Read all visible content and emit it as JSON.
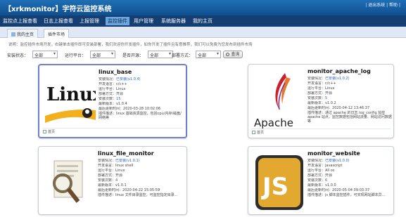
{
  "app": {
    "title": "【xrkmonitor】字符云监控系统",
    "top_right": "| 退出系统 | 帮助 |"
  },
  "nav": {
    "items": [
      {
        "label": "监控点上报查看",
        "active": false
      },
      {
        "label": "日志上报查看",
        "active": false
      },
      {
        "label": "上报管理",
        "active": false
      },
      {
        "label": "监控插件",
        "active": true
      },
      {
        "label": "用户管理",
        "active": false
      },
      {
        "label": "系统服务器",
        "active": false
      },
      {
        "label": "我的主页",
        "active": false
      }
    ]
  },
  "tabs": [
    {
      "label": "我的主页"
    },
    {
      "label": "插件市场"
    }
  ],
  "info_text": "说明：监控插件市场开发，右键单击插件即可安装部署，我们欢迎你开发插件，如你开发了插件且有意推荐，我们可以免费为您发布到插件市场",
  "filters": {
    "install_label": "安装状态：",
    "install_value": "全部",
    "platform_label": "运行平台：",
    "platform_value": "全部",
    "open_label": "是否开源：",
    "open_value": "全部",
    "deploy_label": "部署方式：",
    "deploy_value": "全部",
    "search_label": "查询"
  },
  "plugins": [
    {
      "name": "linux_base",
      "logo": "linux-logo",
      "attrs": [
        {
          "k": "安装情况：",
          "v": "已安装(v1.0.4)",
          "link": true
        },
        {
          "k": "开发语言：",
          "v": "c/c++"
        },
        {
          "k": "运行平台：",
          "v": "Linux"
        },
        {
          "k": "部署方式：",
          "v": "开源"
        },
        {
          "k": "安装次数：",
          "v": "15"
        },
        {
          "k": "最新版本：",
          "v": "v1.0.4"
        },
        {
          "k": "最后更新时间：",
          "v": "2020-03-28 10:02:06"
        }
      ],
      "desc": "插件描述：linux 基础资源监控，包括cpu/内存/磁盘/网络等",
      "footer": "首页"
    },
    {
      "name": "monitor_apache_log",
      "logo": "apache-logo",
      "attrs": [
        {
          "k": "安装情况：",
          "v": "已安装(v1.0.2)",
          "link": true
        },
        {
          "k": "开发语言：",
          "v": "c/c++"
        },
        {
          "k": "运行平台：",
          "v": "Linux"
        },
        {
          "k": "部署方式：",
          "v": "开源"
        },
        {
          "k": "安装次数：",
          "v": "5"
        },
        {
          "k": "最新版本：",
          "v": "v1.0.2"
        },
        {
          "k": "最后更新时间：",
          "v": "2020-04-12 13:46:37"
        }
      ],
      "desc": "插件描述：通过 apache 的日志 log_config 监控 apache 站点，监控数据包括网站流量、网站访问数据等",
      "footer": "首页"
    },
    {
      "name": "linux_file_monitor",
      "logo": "file-monitor-logo",
      "attrs": [
        {
          "k": "安装情况：",
          "v": "已安装(v1.0.1)",
          "link": true
        },
        {
          "k": "开发语言：",
          "v": "linux shell"
        },
        {
          "k": "运行平台：",
          "v": "Linux"
        },
        {
          "k": "部署方式：",
          "v": "开源"
        },
        {
          "k": "安装次数：",
          "v": "4"
        },
        {
          "k": "最新版本：",
          "v": "v1.0.1"
        },
        {
          "k": "最后更新时间：",
          "v": "2020-04-22 15:05:59"
        }
      ],
      "desc": "插件描述：linux 文件目录监控，可监控指定目录...",
      "footer": ""
    },
    {
      "name": "monitor_website",
      "logo": "js-logo",
      "attrs": [
        {
          "k": "安装情况：",
          "v": "已安装(v1.0.0)",
          "link": true
        },
        {
          "k": "开发语言：",
          "v": "javascript"
        },
        {
          "k": "运行平台：",
          "v": "All  os"
        },
        {
          "k": "部署方式：",
          "v": "开源"
        },
        {
          "k": "安装次数：",
          "v": "6"
        },
        {
          "k": "最新版本：",
          "v": "v1.0.0"
        },
        {
          "k": "最后更新时间：",
          "v": "2020-05-04 09:03:37"
        }
      ],
      "desc": "插件描述：js 脚本监控插件，可实现网站脚本异...",
      "footer": ""
    }
  ],
  "logo_text": {
    "linux": "Linux",
    "apache": "Apache",
    "js": "JS"
  },
  "colors": {
    "titlebar": "#1f6fb5",
    "navbar": "#153f73",
    "nav_active": "#6da6de",
    "link": "#2a62c9"
  }
}
